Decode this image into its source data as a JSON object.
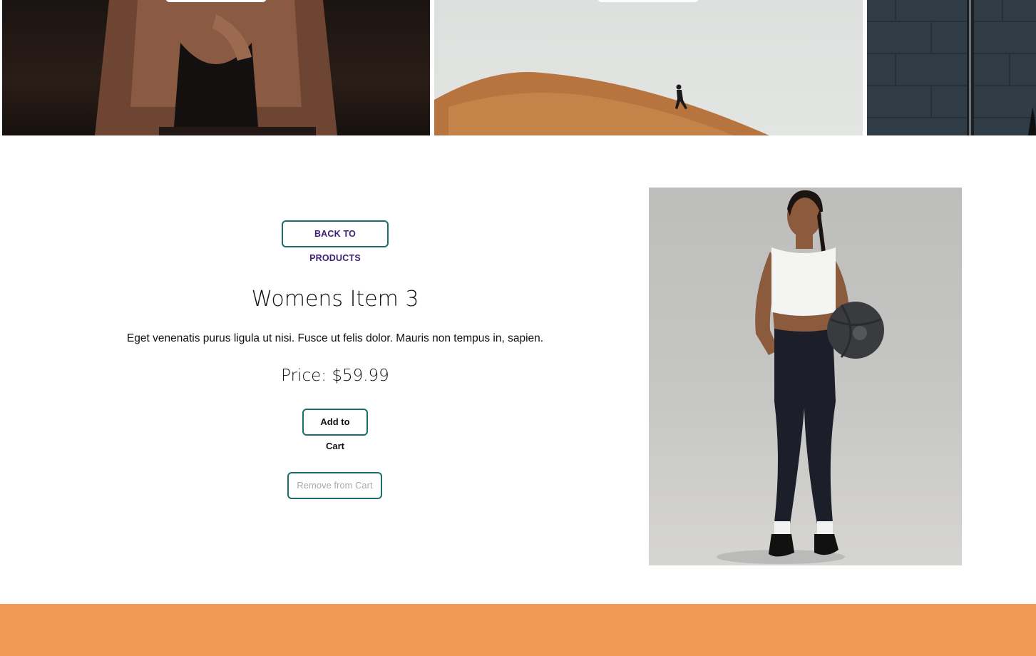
{
  "hero": {
    "tiles": [
      {
        "description_icon": "athlete-back-photo"
      },
      {
        "description_icon": "runner-on-rock-photo"
      },
      {
        "description_icon": "gym-wall-photo"
      }
    ]
  },
  "product": {
    "back_label": "BACK TO PRODUCTS",
    "title": "Womens Item 3",
    "description": "Eget venenatis purus ligula ut nisi. Fusce ut felis dolor. Mauris non tempus in, sapien.",
    "price": "Price: $59.99",
    "add_to_cart_label": "Add to Cart",
    "remove_from_cart_label": "Remove from Cart",
    "image_icon": "product-photo"
  },
  "colors": {
    "button_border": "#1b6e6b",
    "back_text": "#3b1f7a",
    "disabled_text": "#a9a9a9",
    "footer": "#f19a58"
  }
}
